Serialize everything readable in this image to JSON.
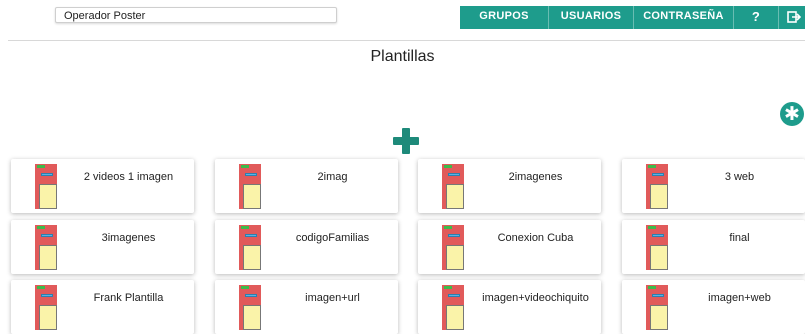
{
  "header": {
    "user_name": "Operador Poster"
  },
  "nav": {
    "grupos": "GRUPOS",
    "usuarios": "USUARIOS",
    "contrasena": "CONTRASEÑA",
    "help": "?",
    "logout_icon": "logout-icon"
  },
  "page": {
    "title": "Plantillas",
    "settings_icon": "asterisk-icon",
    "add_icon": "plus-icon"
  },
  "templates": [
    "2 videos 1 imagen",
    "2imag",
    "2imagenes",
    "3 web",
    "3imagenes",
    "codigoFamilias",
    "Conexion Cuba",
    "final",
    "Frank Plantilla",
    "imagen+url",
    "imagen+videochiquito",
    "imagen+web"
  ],
  "colors": {
    "accent": "#1e9c8c",
    "thumb_red": "#e15a5a",
    "thumb_yellow": "#faf3a9",
    "thumb_green": "#3dbb4a",
    "thumb_blue": "#5ab2e6"
  }
}
